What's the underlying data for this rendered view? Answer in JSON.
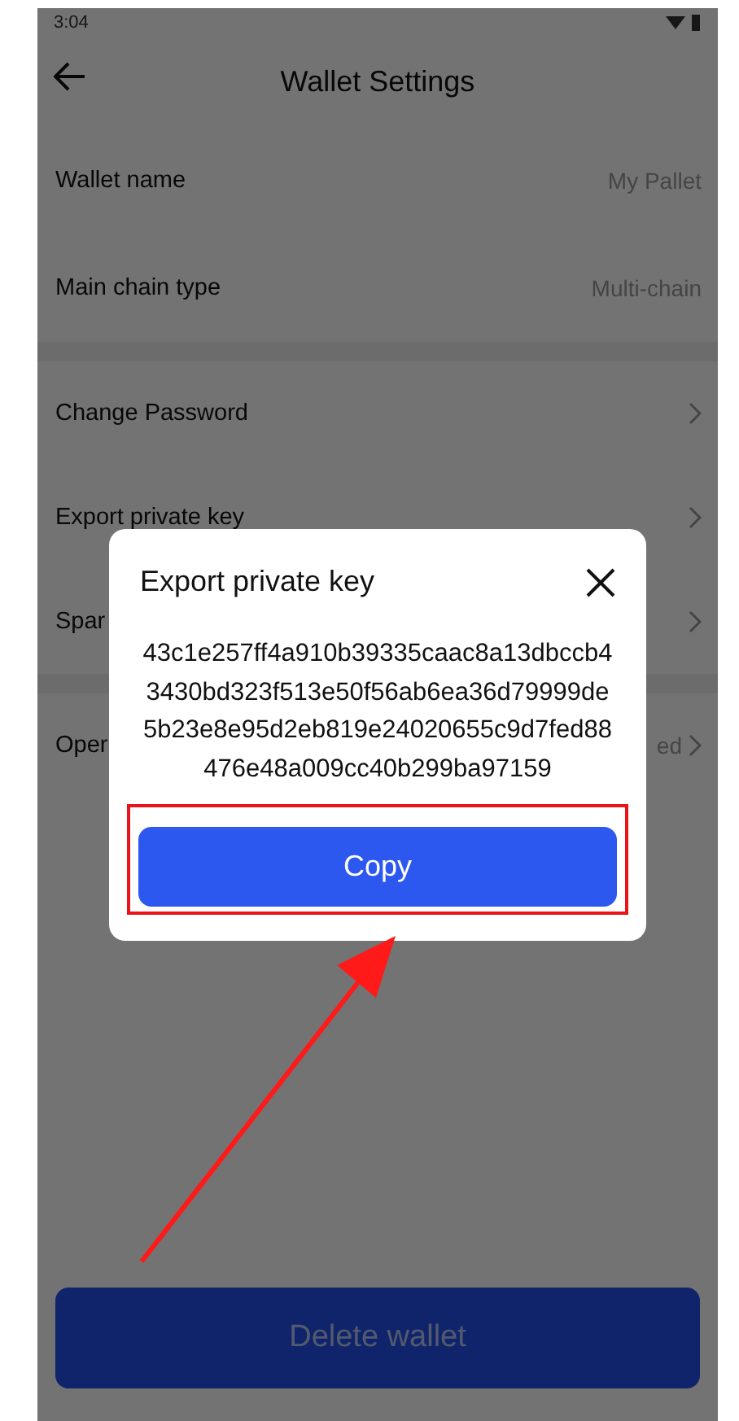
{
  "status_bar": {
    "time": "3:04"
  },
  "header": {
    "title": "Wallet Settings"
  },
  "info_rows": [
    {
      "label": "Wallet name",
      "value": "My Pallet"
    },
    {
      "label": "Main chain type",
      "value": "Multi-chain"
    }
  ],
  "action_groups": [
    [
      {
        "label": "Change Password"
      },
      {
        "label": "Export private key"
      },
      {
        "label": "Spar"
      }
    ],
    [
      {
        "label": "Oper",
        "value": "ed"
      }
    ]
  ],
  "delete_button": "Delete wallet",
  "dialog": {
    "title": "Export private key",
    "key_lines": [
      "43c1e257ff4a910b39335caac8a13dbccb4",
      "3430bd323f513e50f56ab6ea36d79999de",
      "5b23e8e95d2eb819e24020655c9d7fed88",
      "476e48a009cc40b299ba97159"
    ],
    "copy_button": "Copy"
  },
  "annotations": {
    "highlight_copy": true,
    "arrow": true
  }
}
